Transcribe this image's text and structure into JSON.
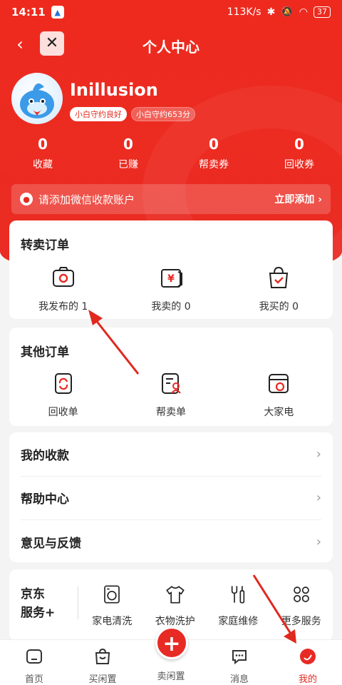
{
  "status_bar": {
    "time": "14:11",
    "speed": "113K/s",
    "battery": "37"
  },
  "nav": {
    "back": "‹",
    "close": "✕",
    "title": "个人中心"
  },
  "profile": {
    "username": "Inillusion",
    "badges": [
      "小白守约良好",
      "小白守约653分"
    ]
  },
  "stats": [
    {
      "value": "0",
      "label": "收藏"
    },
    {
      "value": "0",
      "label": "已赚"
    },
    {
      "value": "0",
      "label": "帮卖券"
    },
    {
      "value": "0",
      "label": "回收券"
    }
  ],
  "wechat_bar": {
    "text": "请添加微信收款账户",
    "action": "立即添加 ›"
  },
  "resale_orders": {
    "title": "转卖订单",
    "items": [
      {
        "label": "我发布的 1",
        "icon": "camera-bag-icon"
      },
      {
        "label": "我卖的 0",
        "icon": "yuan-wallet-icon"
      },
      {
        "label": "我买的 0",
        "icon": "shopping-bag-icon"
      }
    ]
  },
  "other_orders": {
    "title": "其他订单",
    "items": [
      {
        "label": "回收单",
        "icon": "recycle-icon"
      },
      {
        "label": "帮卖单",
        "icon": "person-doc-icon"
      },
      {
        "label": "大家电",
        "icon": "appliance-icon"
      }
    ]
  },
  "menu": [
    {
      "label": "我的收款"
    },
    {
      "label": "帮助中心"
    },
    {
      "label": "意见与反馈"
    }
  ],
  "services": {
    "brand_line1": "京东",
    "brand_line2": "服务+",
    "items": [
      {
        "label": "家电清洗",
        "icon": "washer-icon"
      },
      {
        "label": "衣物洗护",
        "icon": "shirt-icon"
      },
      {
        "label": "家庭维修",
        "icon": "wrench-icon"
      },
      {
        "label": "更多服务",
        "icon": "grid-icon"
      }
    ]
  },
  "tabbar": [
    {
      "label": "首页",
      "icon": "home-icon"
    },
    {
      "label": "买闲置",
      "icon": "shopping-bag-icon"
    },
    {
      "label": "卖闲置",
      "icon": "plus-icon"
    },
    {
      "label": "消息",
      "icon": "chat-icon"
    },
    {
      "label": "我的",
      "icon": "profile-swirl-icon"
    }
  ],
  "colors": {
    "brand_red": "#e82a24",
    "background": "#f4f4f4"
  }
}
